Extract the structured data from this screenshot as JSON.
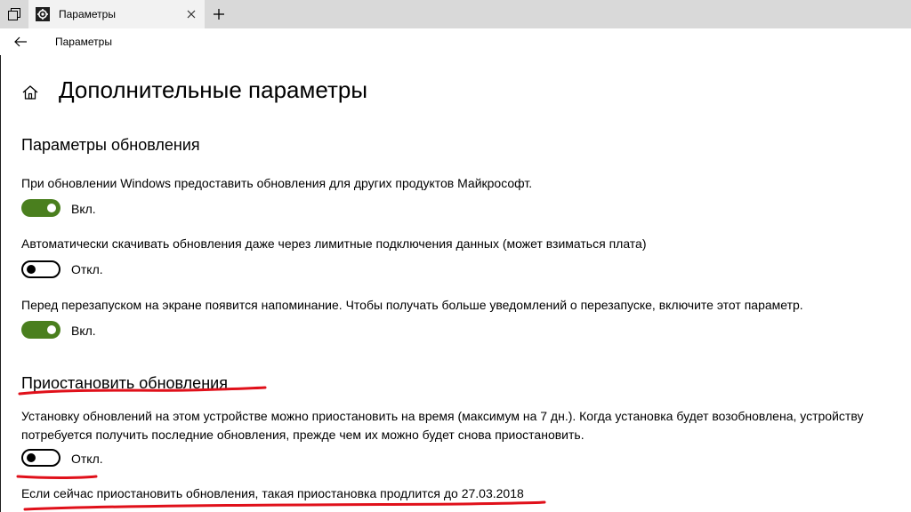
{
  "window": {
    "tab_title": "Параметры",
    "icons": {
      "tab_switcher": "task-view-icon",
      "tab": "gear-icon",
      "close": "close-icon",
      "new_tab": "plus-icon"
    }
  },
  "nav": {
    "back_icon": "back-arrow-icon",
    "title": "Параметры"
  },
  "page": {
    "home_icon": "home-icon",
    "title": "Дополнительные параметры"
  },
  "update_options": {
    "title": "Параметры обновления",
    "settings": [
      {
        "description": "При обновлении Windows предоставить обновления для других продуктов Майкрософт.",
        "state": "on",
        "state_label": "Вкл."
      },
      {
        "description": "Автоматически скачивать обновления даже через лимитные подключения данных (может взиматься плата)",
        "state": "off",
        "state_label": "Откл."
      },
      {
        "description": "Перед перезапуском на экране появится напоминание. Чтобы получать больше уведомлений о перезапуске, включите этот параметр.",
        "state": "on",
        "state_label": "Вкл."
      }
    ]
  },
  "pause_updates": {
    "title": "Приостановить обновления",
    "description_line1": "Установку обновлений на этом устройстве можно приостановить на время (максимум на 7 дн.). Когда установка будет возобновлена, устройству",
    "description_line2": "потребуется получить последние обновления, прежде чем их можно будет снова приостановить.",
    "state": "off",
    "state_label": "Откл.",
    "note": "Если сейчас приостановить обновления, такая приостановка продлится до 27.03.2018"
  },
  "colors": {
    "toggle_on": "#4a7f1e",
    "tabbar": "#d9d9d9",
    "annotation": "#e0101a"
  }
}
